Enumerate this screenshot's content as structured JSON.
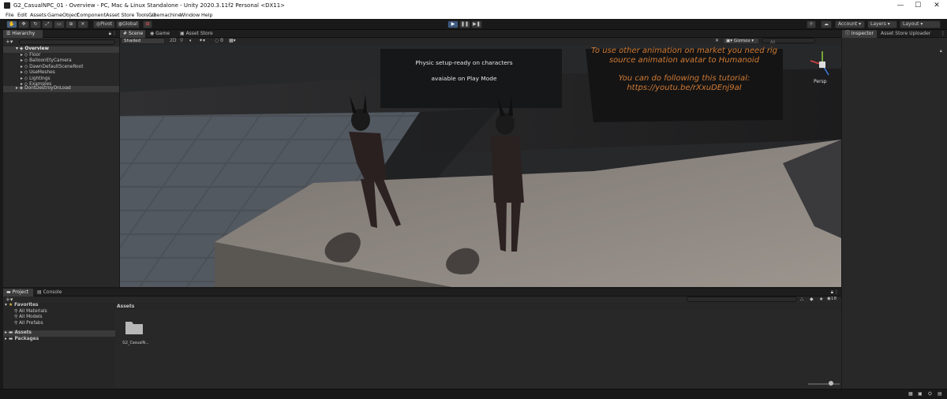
{
  "window": {
    "title": "G2_CasualNPC_01 - Overview - PC, Mac & Linux Standalone - Unity 2020.3.11f2 Personal <DX11>",
    "controls": [
      "—",
      "☐",
      "✕"
    ]
  },
  "menu": [
    "File",
    "Edit",
    "Assets",
    "GameObject",
    "Component",
    "Asset Store Tools v2",
    "Cinemachine",
    "Window",
    "Help"
  ],
  "toolbar": {
    "pivot_label": "Pivot",
    "global_label": "Global",
    "account_label": "Account",
    "layers_label": "Layers",
    "layout_label": "Layout"
  },
  "hierarchy": {
    "tab_label": "Hierarchy",
    "root": "Overview",
    "items": [
      "Floor",
      "BalloonEtyCamera",
      "DawnDefaultSceneRoot",
      "UseMeshes",
      "Lightings",
      "Examples"
    ],
    "dont_destroy": "DontDestroyOnLoad"
  },
  "scene": {
    "tabs": [
      "Scene",
      "Game",
      "Asset Store"
    ],
    "shading_mode": "Shaded",
    "gizmos_label": "Gizmos",
    "search_placeholder": "All",
    "persp_label": "Persp",
    "mode_toggle": "2D",
    "sign_left_line1": "Physic setup-ready on characters",
    "sign_left_line2": "avaiable on Play Mode",
    "sign_right_line1": "To use other animation on market you need rig",
    "sign_right_line2": "source animation avatar to Humanoid",
    "sign_right_line3": "You can do following this tutorial:",
    "sign_right_line4": "https://youtu.be/rXxuDEnj9aI"
  },
  "inspector": {
    "tabs": [
      "Inspector",
      "Asset Store Uploader"
    ]
  },
  "project": {
    "tabs": [
      "Project",
      "Console"
    ],
    "favorites_label": "Favorites",
    "favorites": [
      "All Materials",
      "All Models",
      "All Prefabs"
    ],
    "folders": [
      "Assets",
      "Packages"
    ],
    "breadcrumb": "Assets",
    "asset_name": "G2_CasualN...",
    "hidden_count": "18"
  },
  "colors": {
    "accent": "#3d5a80",
    "sign_orange": "#d07a32",
    "panel_bg": "#282828"
  }
}
